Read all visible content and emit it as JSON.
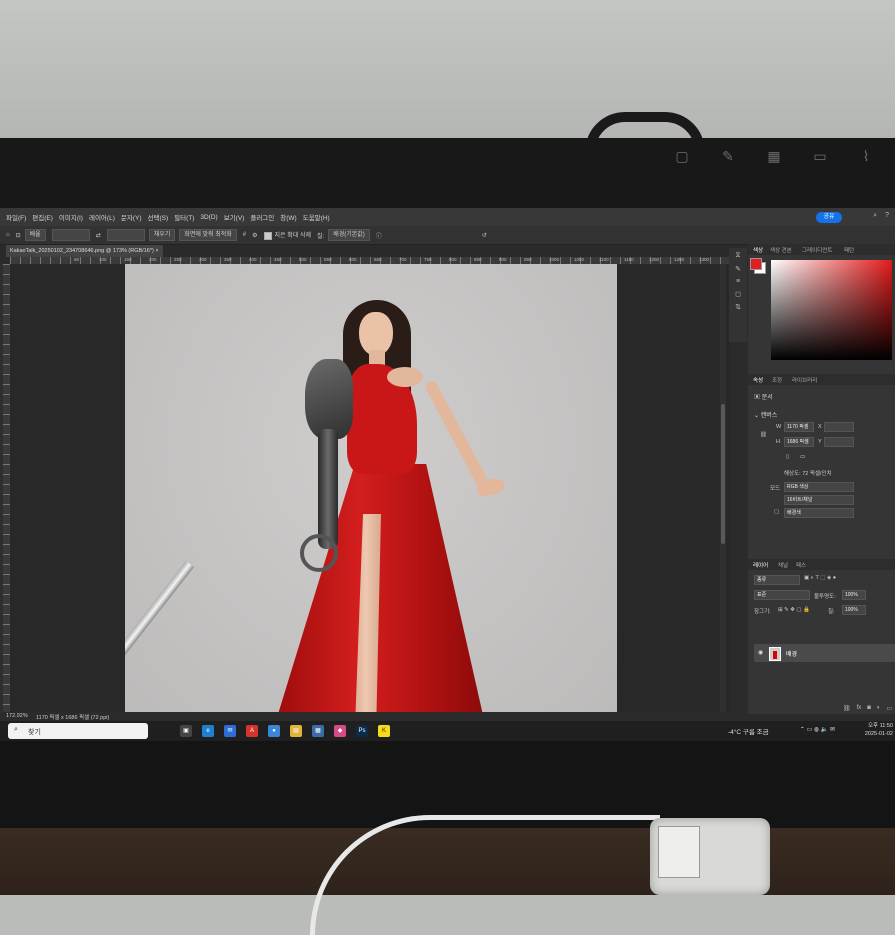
{
  "photo": {
    "monitor_icons": [
      "input-icon",
      "wrench-icon",
      "grid-icon",
      "display-icon",
      "signal-icon"
    ]
  },
  "app": {
    "name": "Photoshop",
    "menu": [
      "파일(F)",
      "편집(E)",
      "이미지(I)",
      "레이어(L)",
      "문자(Y)",
      "선택(S)",
      "필터(T)",
      "3D(D)",
      "보기(V)",
      "플러그인",
      "창(W)",
      "도움말(H)"
    ],
    "share_label": "공유",
    "options": {
      "mode_value": "배율",
      "fill_label": "채우기",
      "fit_label": "화면에 맞춰 최적화",
      "checkbox_label": "지은 확대 삭제",
      "style_label": "칠:",
      "style_value": "배경(기본값)"
    },
    "document_tab": "KakaoTalk_20250102_234708646.png @ 173% (RGB/16*)",
    "ruler_ticks": [
      "50",
      "100",
      "150",
      "200",
      "250",
      "300",
      "350",
      "400",
      "450",
      "500",
      "550",
      "600",
      "650",
      "700",
      "750",
      "800",
      "850",
      "900",
      "950",
      "1000",
      "1050",
      "1100",
      "1150",
      "1200",
      "1250",
      "1300"
    ],
    "status": {
      "zoom": "172.92%",
      "dims": "1170 픽셀 x 1686 픽셀 (72 ppi)"
    }
  },
  "panels": {
    "color_tabs": [
      "색상",
      "색상 견본",
      "그레이디언트",
      "패턴"
    ],
    "properties_tabs": [
      "속성",
      "조정",
      "라이브러리"
    ],
    "doc_label": "문서",
    "canvas_section": "캔버스",
    "width_label": "W",
    "width_value": "1170 픽셀",
    "height_label": "H",
    "height_value": "1686 픽셀",
    "x_label": "X",
    "y_label": "Y",
    "resolution": "해상도: 72 픽셀/인치",
    "mode_label": "모드",
    "mode_value": "RGB 색상",
    "depth_value": "16비트/채널",
    "bg_label": "배경색",
    "layers_tabs": [
      "레이어",
      "채널",
      "패스"
    ],
    "layer_kind": "종류",
    "blend_mode": "표준",
    "opacity_label": "불투명도:",
    "opacity_value": "100%",
    "lock_label": "잠그기:",
    "fill_label": "칠:",
    "fill_value": "100%",
    "layer_name": "배경"
  },
  "taskbar": {
    "search_placeholder": "찾기",
    "weather": "-4°C  구름 조금",
    "time": "오후 11:50",
    "date": "2025-01-02",
    "apps": [
      {
        "name": "task-view",
        "color": "#444444",
        "glyph": "▣"
      },
      {
        "name": "edge",
        "color": "#1f7fd1",
        "glyph": "e"
      },
      {
        "name": "mail",
        "color": "#2c6ed5",
        "glyph": "✉"
      },
      {
        "name": "acrobat",
        "color": "#d8332f",
        "glyph": "A"
      },
      {
        "name": "chat",
        "color": "#3a87d6",
        "glyph": "●"
      },
      {
        "name": "explorer",
        "color": "#e3b43d",
        "glyph": "▤"
      },
      {
        "name": "store",
        "color": "#3b6ca8",
        "glyph": "▦"
      },
      {
        "name": "app-pink",
        "color": "#d64a86",
        "glyph": "◆"
      },
      {
        "name": "photoshop",
        "color": "#0b2b4a",
        "glyph": "Ps"
      },
      {
        "name": "kakaotalk",
        "color": "#f6dc18",
        "glyph": "K"
      }
    ]
  },
  "colors": {
    "accent": "#1473e6",
    "dress": "#c91717",
    "canvas": "#c8c6c5"
  }
}
